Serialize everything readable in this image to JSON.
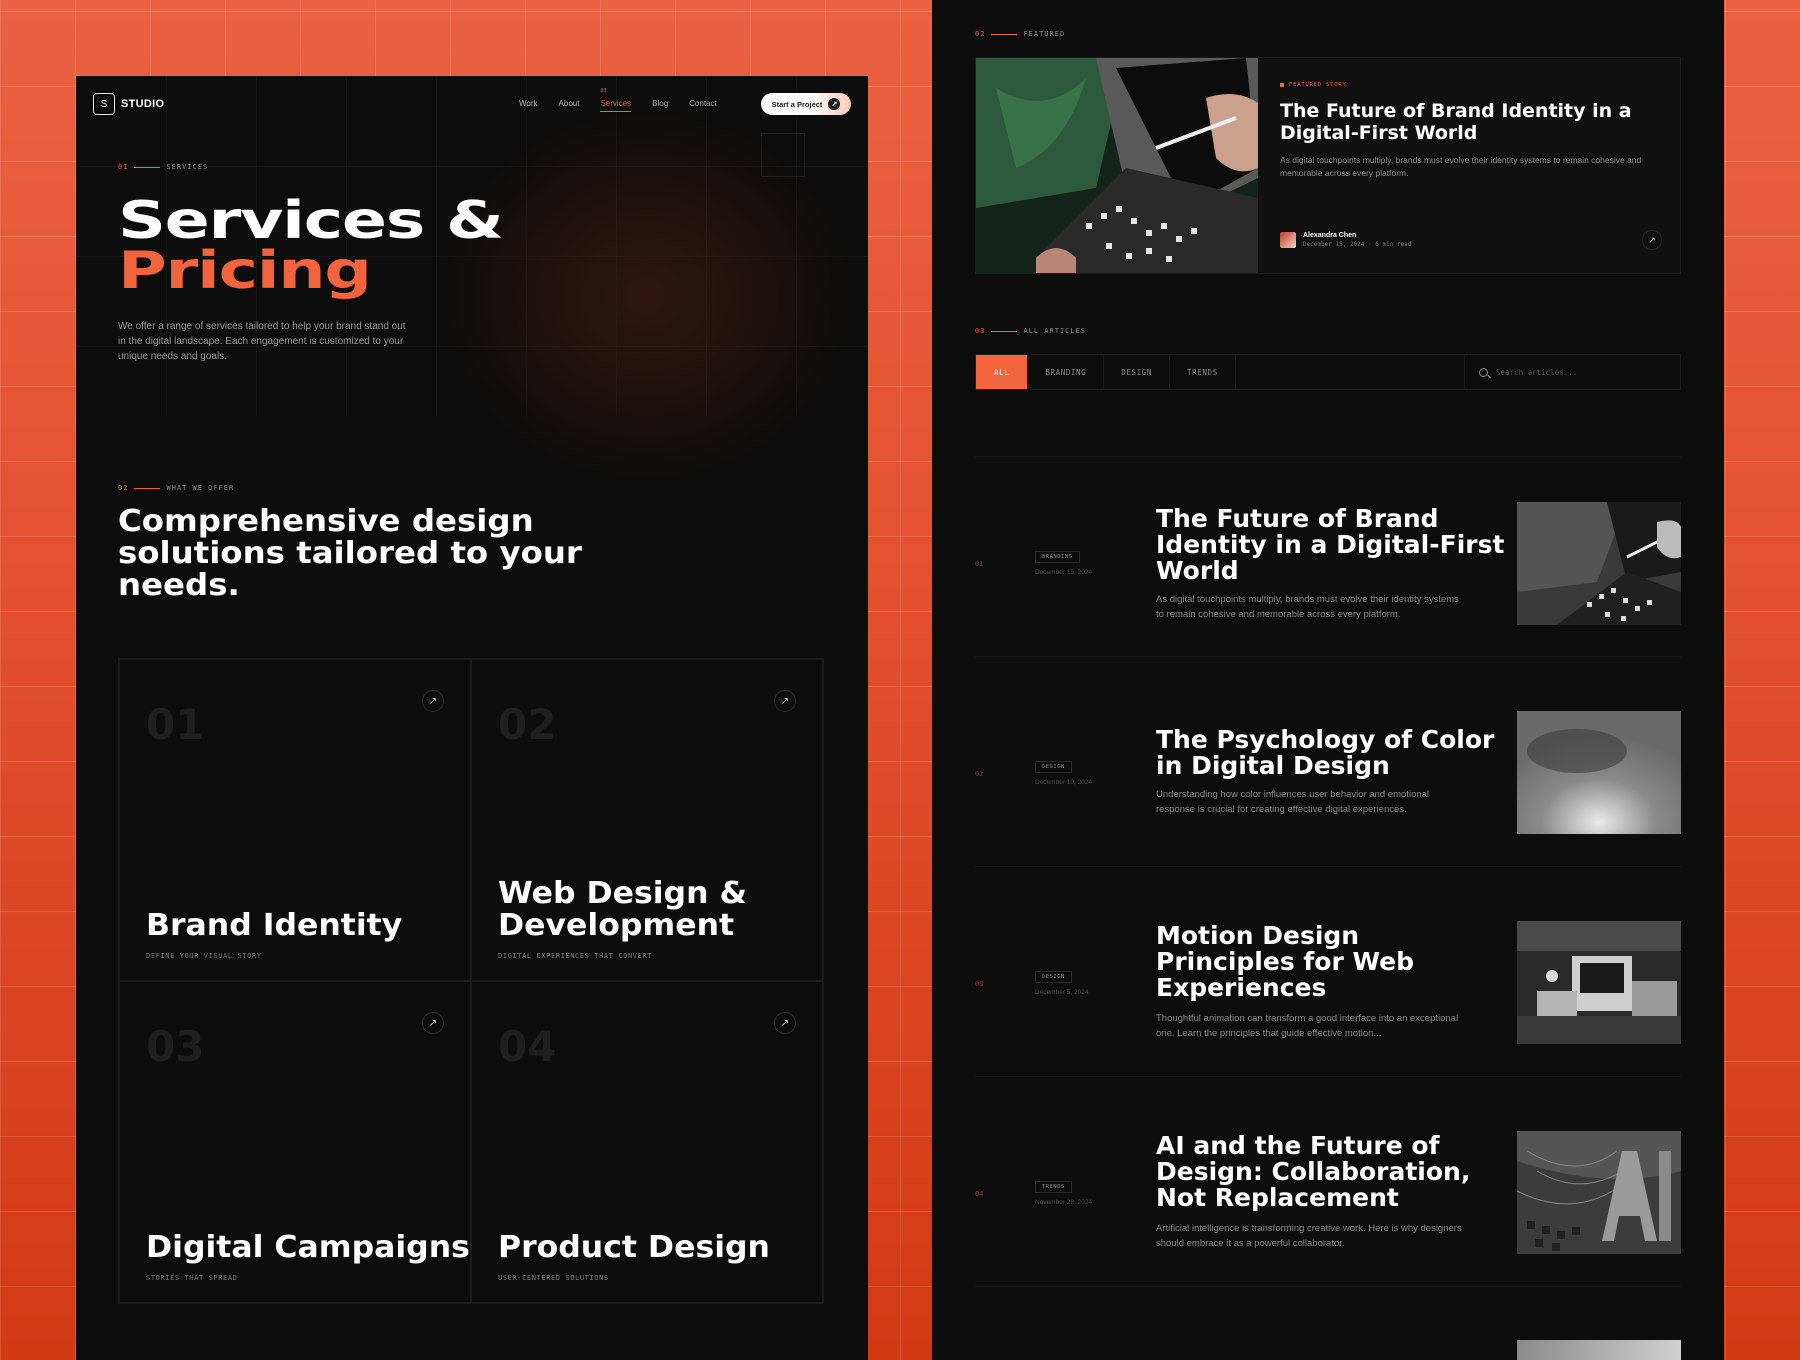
{
  "colors": {
    "accent": "#f2643e",
    "panel_bg": "#0d0d0d",
    "background": "#e3502e"
  },
  "left": {
    "nav": {
      "logo_mark": "S",
      "logo_text": "STUDIO",
      "links": [
        "Work",
        "About",
        "Services",
        "Blog",
        "Contact"
      ],
      "active_badge": "03",
      "cta_label": "Start a Project",
      "cta_icon": "arrow-up-right-icon"
    },
    "hero": {
      "section_num": "01",
      "section_label": "SERVICES",
      "title_line1": "Services &",
      "title_line2": "Pricing",
      "description": "We offer a range of services tailored to help your brand stand out in the digital landscape. Each engagement is customized to your unique needs and goals."
    },
    "offer": {
      "section_num": "02",
      "section_label": "WHAT WE OFFER",
      "heading": "Comprehensive design solutions tailored to your needs."
    },
    "services": [
      {
        "num": "01",
        "title": "Brand Identity",
        "subtitle": "DEFINE YOUR VISUAL STORY"
      },
      {
        "num": "02",
        "title": "Web Design & Development",
        "subtitle": "DIGITAL EXPERIENCES THAT CONVERT"
      },
      {
        "num": "03",
        "title": "Digital Campaigns",
        "subtitle": "STORIES THAT SPREAD"
      },
      {
        "num": "04",
        "title": "Product Design",
        "subtitle": "USER-CENTERED SOLUTIONS"
      }
    ]
  },
  "right": {
    "featured_section": {
      "num": "02",
      "label": "FEATURED"
    },
    "featured": {
      "kicker": "FEATURED STORY",
      "title": "The Future of Brand Identity in a Digital-First World",
      "description": "As digital touchpoints multiply, brands must evolve their identity systems to remain cohesive and memorable across every platform.",
      "author": "Alexandra Chen",
      "meta": "December 15, 2024 · 6 min read"
    },
    "articles_section": {
      "num": "03",
      "label": "ALL ARTICLES"
    },
    "filters": [
      "ALL",
      "BRANDING",
      "DESIGN",
      "TRENDS"
    ],
    "search_placeholder": "Search articles...",
    "articles": [
      {
        "num": "01",
        "tag": "BRANDING",
        "date": "December 15, 2024",
        "title": "The Future of Brand Identity in a Digital-First World",
        "description": "As digital touchpoints multiply, brands must evolve their identity systems to remain cohesive and memorable across every platform."
      },
      {
        "num": "02",
        "tag": "DESIGN",
        "date": "December 10, 2024",
        "title": "The Psychology of Color in Digital Design",
        "description": "Understanding how color influences user behavior and emotional response is crucial for creating effective digital experiences."
      },
      {
        "num": "03",
        "tag": "DESIGN",
        "date": "December 5, 2024",
        "title": "Motion Design Principles for Web Experiences",
        "description": "Thoughtful animation can transform a good interface into an exceptional one. Learn the principles that guide effective motion..."
      },
      {
        "num": "04",
        "tag": "TRENDS",
        "date": "November 28, 2024",
        "title": "AI and the Future of Design: Collaboration, Not Replacement",
        "description": "Artificial intelligence is transforming creative work. Here is why designers should embrace it as a powerful collaborator."
      }
    ]
  }
}
